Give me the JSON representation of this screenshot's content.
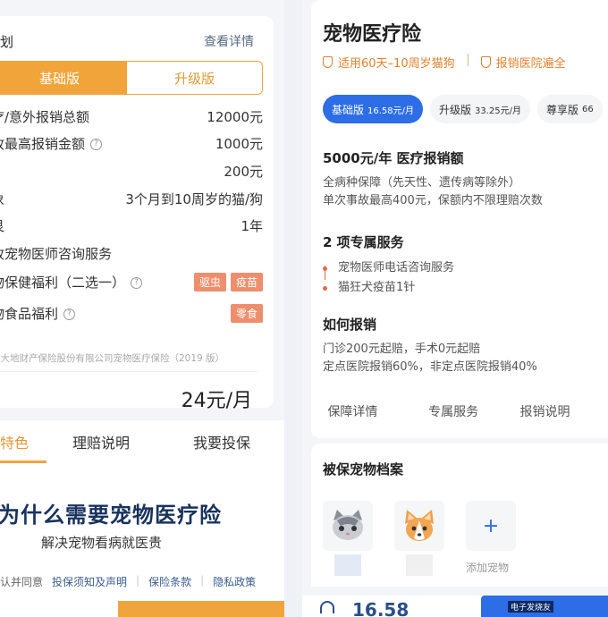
{
  "left": {
    "section_title": "划",
    "details_link": "查看详情",
    "plan_tabs": [
      "基础版",
      "升级版"
    ],
    "rows": [
      {
        "label": "疗/意外报销总额",
        "value": "12000元"
      },
      {
        "label": "故最高报销金额",
        "value": "1000元"
      },
      {
        "label": "",
        "value": "200元"
      },
      {
        "label": "象",
        "value": "3个月到10周岁的猫/狗"
      },
      {
        "label": "艮",
        "value": "1年"
      },
      {
        "label": "故宠物医师咨询服务",
        "value": ""
      },
      {
        "label": "物保健福利（二选一）",
        "tags": [
          "驱虫",
          "疫苗"
        ]
      },
      {
        "label": "物食品福利",
        "tags": [
          "零食"
        ]
      }
    ],
    "note": "国大地财产保险股份有限公司宠物医疗保险（2019 版）",
    "price": "24元/月",
    "tabs": [
      "特色",
      "理赔说明",
      "我要投保"
    ],
    "banner_title": "为什么需要宠物医疗险",
    "banner_sub": "解决宠物看病就医贵",
    "footer_links": [
      "认并同意",
      "投保须知及声明",
      "保险条款",
      "隐私政策"
    ]
  },
  "right": {
    "title": "宠物医疗险",
    "badges": [
      "适用60天–10周岁猫狗",
      "报销医院遍全"
    ],
    "plans": [
      {
        "name": "基础版",
        "price": "16.58元/月"
      },
      {
        "name": "升级版",
        "price": "33.25元/月"
      },
      {
        "name": "尊享版",
        "price": "66"
      }
    ],
    "amount_title": "5000元/年 医疗报销额",
    "amount_lines": [
      "全病种保障（先天性、遗传病等除外）",
      "单次事故最高400元，保额内不限理赔次数"
    ],
    "service_title": "2 项专属服务",
    "services": [
      "宠物医师电话咨询服务",
      "猫狂犬疫苗1针"
    ],
    "claim_title": "如何报销",
    "claim_lines": [
      "门诊200元起赔，手术0元起赔",
      "定点医院报销60%，非定点医院报销40%"
    ],
    "tabs": [
      "保障详情",
      "专属服务",
      "报销说明"
    ],
    "pet_title": "被保宠物档案",
    "add_pet": "添加宠物",
    "footer_price": "16.58",
    "watermark": "电子发烧友"
  },
  "colors": {
    "orange": "#f1a43a",
    "blue": "#2d6de6",
    "navy": "#18325e",
    "tag": "#ef8e6d"
  }
}
